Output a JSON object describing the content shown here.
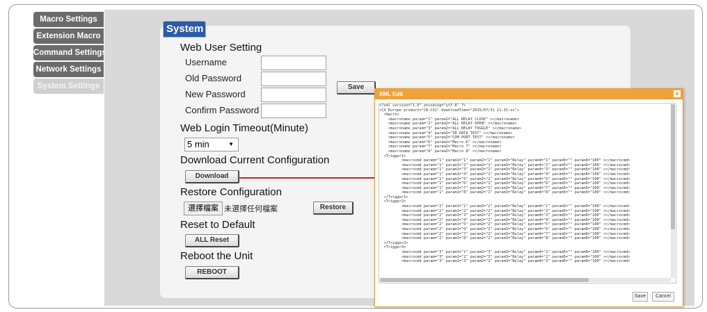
{
  "sidebar": {
    "items": [
      {
        "label": "Macro Settings"
      },
      {
        "label": "Extension Macro"
      },
      {
        "label": "Command Settings"
      },
      {
        "label": "Network Settings"
      },
      {
        "label": "System Settings"
      }
    ]
  },
  "panel": {
    "title": "System"
  },
  "web_user": {
    "heading": "Web User Setting",
    "username_label": "Username",
    "old_password_label": "Old Password",
    "new_password_label": "New Password",
    "confirm_password_label": "Confirm Password",
    "save_label": "Save"
  },
  "timeout": {
    "heading": "Web Login Timeout(Minute)",
    "selected": "5 min"
  },
  "download": {
    "heading": "Download Current Configuration",
    "button": "Download"
  },
  "restore": {
    "heading": "Restore Configuration",
    "choose_file": "選擇檔案",
    "no_file": "未選擇任何檔案",
    "button": "Restore"
  },
  "reset": {
    "heading": "Reset to Default",
    "button": "ALL Reset"
  },
  "reboot": {
    "heading": "Reboot the Unit",
    "button": "REBOOT"
  },
  "xml_dialog": {
    "title": "XML Edit",
    "close": "x",
    "save": "Save",
    "cancel": "Cancel",
    "lines": [
      "<?xml version=\"1.0\" encoding=\"utf-8\" ?>",
      "<CX_Europe product=\"CR-CS1\" downloadTime=\"2015/07/31 11:15:ss\">",
      "  <macro>",
      "    <macroname param=\"1\" param2=\"ALL RELAY CLOSE\" ></macroname>",
      "    <macroname param=\"2\" param2=\"ALL RELAY OPEN\" ></macroname>",
      "    <macroname param=\"3\" param2=\"ALL RELAY TOGGLE\" ></macroname>",
      "    <macroname param=\"4\" param2=\"IR DATA TEST\" ></macroname>",
      "    <macroname param=\"5\" param2=\"COM PORT TEST\" ></macroname>",
      "    <macroname param=\"6\" param2=\"Macro 6\" ></macroname>",
      "    <macroname param=\"7\" param2=\"Macro 7\" ></macroname>",
      "    <macroname param=\"8\" param2=\"Macro 8\" ></macroname>",
      "  <Trigger1>",
      "          <macrocmd param=\"1\" param1=\"1\" param2=\"1\" param3=\"Relay\" param4=\"1\" param5=\"\" param6=\"100\" ></macrocmd>",
      "          <macrocmd param=\"1\" param1=\"2\" param2=\"1\" param3=\"Relay\" param4=\"2\" param5=\"\" param6=\"100\" ></macrocmd>",
      "          <macrocmd param=\"1\" param1=\"3\" param2=\"1\" param3=\"Relay\" param4=\"3\" param5=\"\" param6=\"100\" ></macrocmd>",
      "          <macrocmd param=\"1\" param1=\"4\" param2=\"1\" param3=\"Relay\" param4=\"4\" param5=\"\" param6=\"100\" ></macrocmd>",
      "          <macrocmd param=\"1\" param1=\"5\" param2=\"1\" param3=\"Relay\" param4=\"5\" param5=\"\" param6=\"100\" ></macrocmd>",
      "          <macrocmd param=\"1\" param1=\"6\" param2=\"1\" param3=\"Relay\" param4=\"6\" param5=\"\" param6=\"100\" ></macrocmd>",
      "          <macrocmd param=\"1\" param1=\"7\" param2=\"1\" param3=\"Relay\" param4=\"7\" param5=\"\" param6=\"100\" ></macrocmd>",
      "          <macrocmd param=\"1\" param1=\"8\" param2=\"1\" param3=\"Relay\" param4=\"8\" param5=\"\" param6=\"100\" ></macrocmd>",
      "  </Trigger1>",
      "  <Trigger2>",
      "          <macrocmd param=\"2\" param1=\"1\" param2=\"2\" param3=\"Relay\" param4=\"1\" param5=\"\" param6=\"100\" ></macrocmd>",
      "          <macrocmd param=\"2\" param1=\"2\" param2=\"2\" param3=\"Relay\" param4=\"2\" param5=\"\" param6=\"100\" ></macrocmd>",
      "          <macrocmd param=\"2\" param1=\"3\" param2=\"2\" param3=\"Relay\" param4=\"3\" param5=\"\" param6=\"100\" ></macrocmd>",
      "          <macrocmd param=\"2\" param1=\"4\" param2=\"2\" param3=\"Relay\" param4=\"4\" param5=\"\" param6=\"100\" ></macrocmd>",
      "          <macrocmd param=\"2\" param1=\"5\" param2=\"2\" param3=\"Relay\" param4=\"5\" param5=\"\" param6=\"100\" ></macrocmd>",
      "          <macrocmd param=\"2\" param1=\"6\" param2=\"2\" param3=\"Relay\" param4=\"6\" param5=\"\" param6=\"100\" ></macrocmd>",
      "          <macrocmd param=\"2\" param1=\"7\" param2=\"2\" param3=\"Relay\" param4=\"7\" param5=\"\" param6=\"100\" ></macrocmd>",
      "          <macrocmd param=\"2\" param1=\"8\" param2=\"2\" param3=\"Relay\" param4=\"8\" param5=\"\" param6=\"100\" ></macrocmd>",
      "  </Trigger2>",
      "  <Trigger3>",
      "          <macrocmd param=\"3\" param1=\"1\" param2=\"3\" param3=\"Relay\" param4=\"1\" param5=\"\" param6=\"100\" ></macrocmd>",
      "          <macrocmd param=\"3\" param1=\"2\" param2=\"3\" param3=\"Relay\" param4=\"2\" param5=\"\" param6=\"100\" ></macrocmd>",
      "          <macrocmd param=\"3\" param1=\"3\" param2=\"3\" param3=\"Relay\" param4=\"3\" param5=\"\" param6=\"100\" ></macrocmd>"
    ]
  },
  "colors": {
    "tab_blue": "#2d5aa4",
    "sidebar_gray": "#6b6b6b",
    "arrow_red": "#cc1f1f",
    "dialog_orange": "#f0a23a"
  }
}
